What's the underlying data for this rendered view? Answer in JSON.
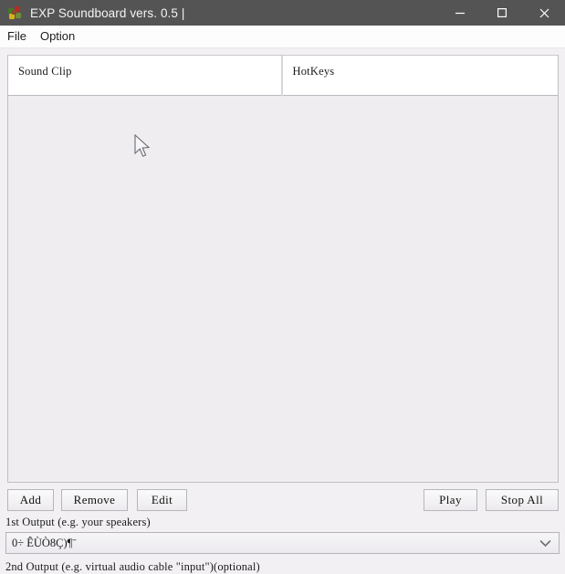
{
  "window": {
    "title": "EXP Soundboard vers. 0.5 |",
    "icon": "puzzle-piece-icon",
    "titlebar_color": "#545454",
    "controls": [
      {
        "name": "minimize",
        "glyph": "minimize-icon"
      },
      {
        "name": "maximize",
        "glyph": "maximize-icon"
      },
      {
        "name": "close",
        "glyph": "close-icon"
      }
    ]
  },
  "menubar": {
    "items": [
      {
        "label": "File"
      },
      {
        "label": "Option"
      }
    ]
  },
  "listview": {
    "columns": [
      {
        "label": "Sound Clip"
      },
      {
        "label": "HotKeys"
      }
    ],
    "rows": [],
    "body_color": "#efedf0"
  },
  "toolbar": {
    "add_label": "Add",
    "remove_label": "Remove",
    "edit_label": "Edit",
    "play_label": "Play",
    "stop_all_label": "Stop All"
  },
  "outputs": {
    "first": {
      "label": "1st Output (e.g. your speakers)",
      "value": "0÷ ÊÙÒ8Ç)¶ˉ",
      "arrow": "chevron-down-icon"
    },
    "second": {
      "label": "2nd Output (e.g. virtual audio cable \"input\")(optional)"
    }
  }
}
